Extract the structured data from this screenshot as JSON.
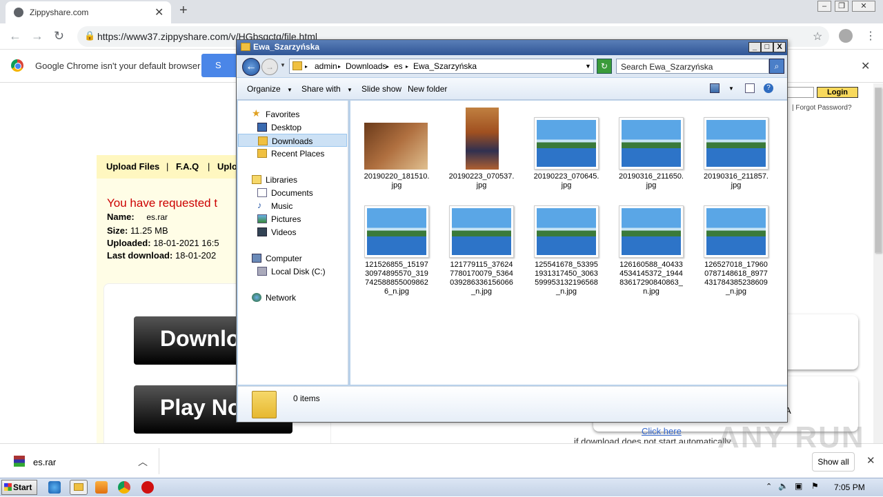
{
  "browser": {
    "tab_title": "Zippyshare.com",
    "url": "https://www37.zippyshare.com/v/HGbsqctq/file.html",
    "infobar_message": "Google Chrome isn't your default browser",
    "infobar_button": "S"
  },
  "page": {
    "menu": [
      "Upload Files",
      "F.A.Q",
      "Uplo"
    ],
    "requested": "You have requested t",
    "name_label": "Name:",
    "name_value": "es.rar",
    "size_label": "Size:",
    "size_value": "11.25 MB",
    "uploaded_label": "Uploaded:",
    "uploaded_value": "18-01-2021 16:5",
    "lastdl_label": "Last download:",
    "lastdl_value": "18-01-202",
    "download_btn": "Downlo",
    "play_btn": "Play No",
    "login_btn": "Login",
    "forgot": "Forgot Password?",
    "click_here": "Click here",
    "auto_msg": "if download does not start automatically",
    "right_letter": "A"
  },
  "shelf": {
    "file_name": "es.rar",
    "show_all": "Show all"
  },
  "watermark": "ANY RUN",
  "taskbar": {
    "start": "Start",
    "clock": "7:05 PM"
  },
  "explorer": {
    "title": "Ewa_Szarzyńska",
    "breadcrumbs": [
      "admin",
      "Downloads",
      "es",
      "Ewa_Szarzyńska"
    ],
    "search_placeholder": "Search Ewa_Szarzyńska",
    "commands": {
      "organize": "Organize",
      "share_with": "Share with",
      "slide_show": "Slide show",
      "new_folder": "New folder"
    },
    "nav": {
      "favorites": "Favorites",
      "desktop": "Desktop",
      "downloads": "Downloads",
      "recent": "Recent Places",
      "libraries": "Libraries",
      "documents": "Documents",
      "music": "Music",
      "pictures": "Pictures",
      "videos": "Videos",
      "computer": "Computer",
      "local_disk": "Local Disk (C:)",
      "network": "Network"
    },
    "files": [
      {
        "line1": "20190220_181510.",
        "line2": "jpg",
        "line3": "",
        "line4": "",
        "kind": "photo-wide"
      },
      {
        "line1": "20190223_070537.",
        "line2": "jpg",
        "line3": "",
        "line4": "",
        "kind": "photo-tall"
      },
      {
        "line1": "20190223_070645.",
        "line2": "jpg",
        "line3": "",
        "line4": "",
        "kind": "landscape"
      },
      {
        "line1": "20190316_211650.",
        "line2": "jpg",
        "line3": "",
        "line4": "",
        "kind": "landscape"
      },
      {
        "line1": "20190316_211857.",
        "line2": "jpg",
        "line3": "",
        "line4": "",
        "kind": "landscape"
      },
      {
        "line1": "121526855_15197",
        "line2": "30974895570_319",
        "line3": "742588855009862",
        "line4": "6_n.jpg",
        "kind": "landscape"
      },
      {
        "line1": "121779115_37624",
        "line2": "7780170079_5364",
        "line3": "039286336156066",
        "line4": "_n.jpg",
        "kind": "landscape"
      },
      {
        "line1": "125541678_53395",
        "line2": "1931317450_3063",
        "line3": "599953132196568",
        "line4": "_n.jpg",
        "kind": "landscape"
      },
      {
        "line1": "126160588_40433",
        "line2": "4534145372_1944",
        "line3": "83617290840863_",
        "line4": "n.jpg",
        "kind": "landscape"
      },
      {
        "line1": "126527018_17960",
        "line2": "0787148618_8977",
        "line3": "431784385238609",
        "line4": "_n.jpg",
        "kind": "landscape"
      }
    ],
    "status": "0 items"
  }
}
